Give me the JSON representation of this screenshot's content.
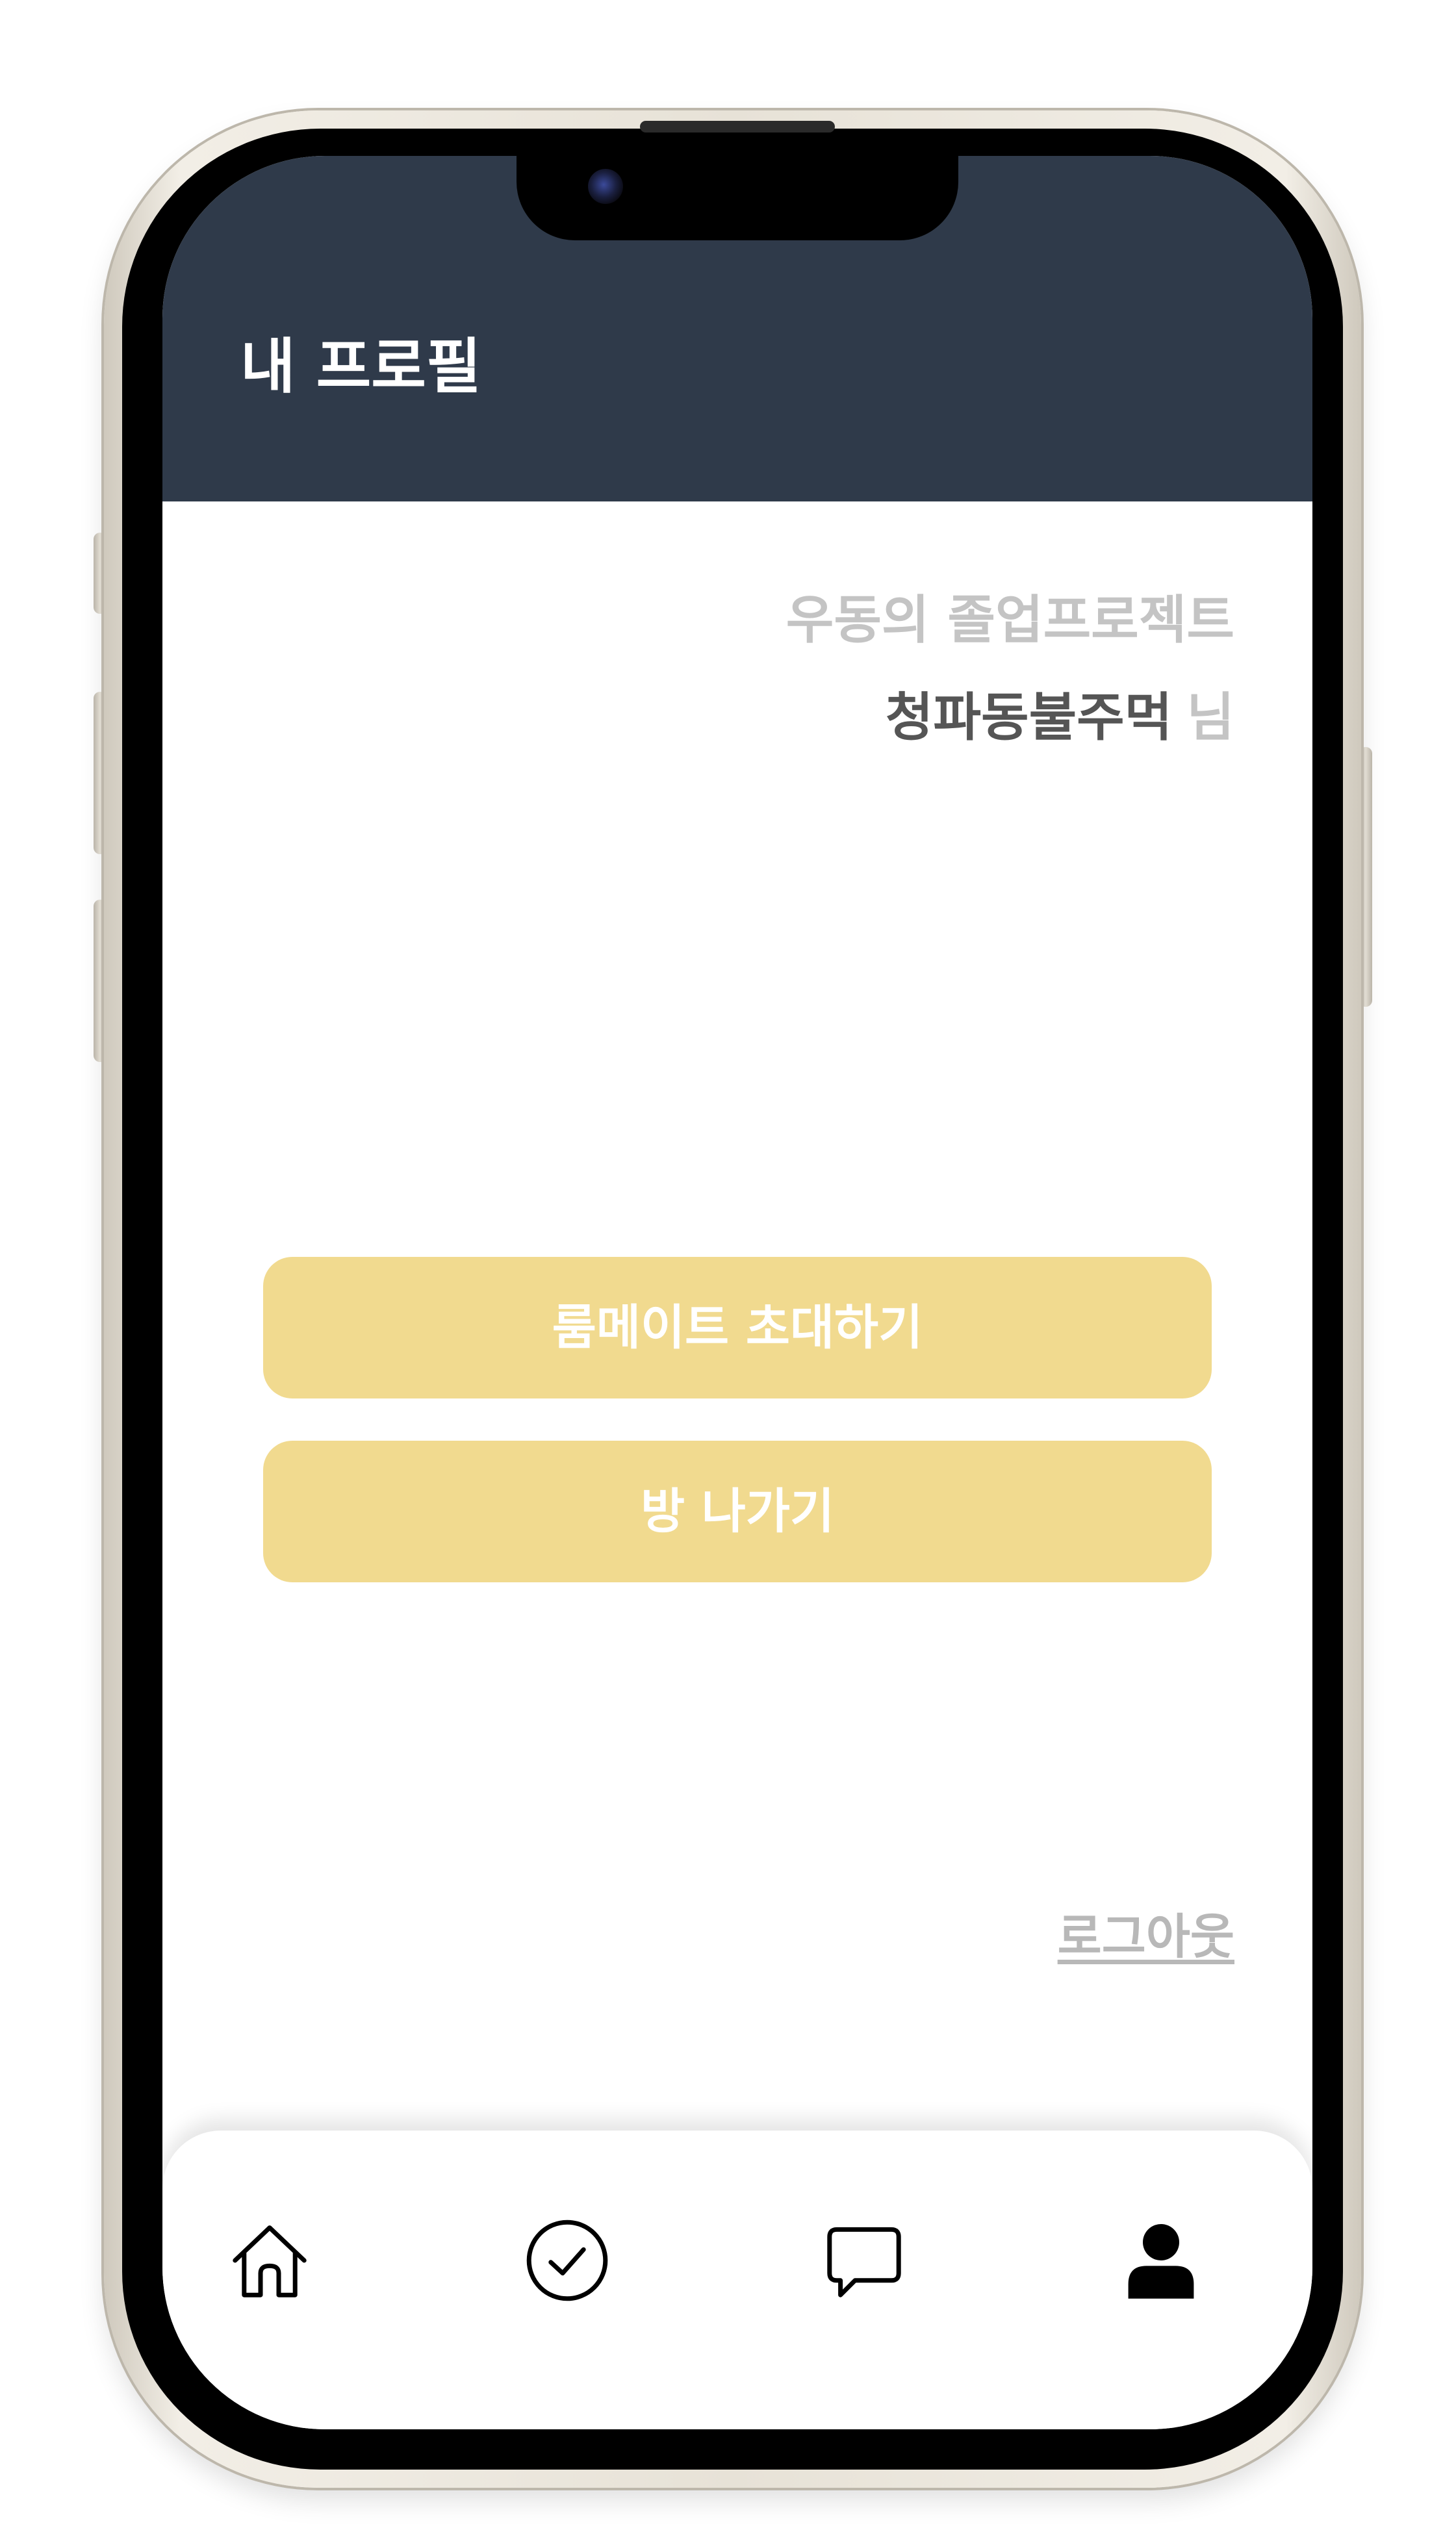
{
  "header": {
    "title": "내 프로필"
  },
  "profile": {
    "project_name": "우동의 졸업프로젝트",
    "user_name": "청파동불주먹",
    "user_suffix": "님"
  },
  "actions": {
    "invite_label": "룸메이트 초대하기",
    "leave_label": "방 나가기"
  },
  "logout_label": "로그아웃",
  "bottom_nav": {
    "items": [
      {
        "icon": "home-icon",
        "active": false
      },
      {
        "icon": "check-circle-icon",
        "active": false
      },
      {
        "icon": "chat-icon",
        "active": false
      },
      {
        "icon": "user-icon",
        "active": true
      }
    ]
  },
  "colors": {
    "header_bg": "#2f3a4a",
    "button_bg": "#f1da8f",
    "muted_text": "#c4c4c4",
    "name_text": "#555555"
  }
}
